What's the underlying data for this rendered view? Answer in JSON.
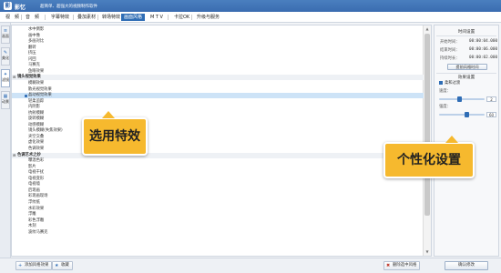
{
  "window": {
    "logo_glyph": "影",
    "app_name": "影忆",
    "slogan": "超简单、超强大的视频制作软件"
  },
  "menu": [
    "视",
    "频",
    "音",
    "频",
    "字幕特效",
    "叠加素材",
    "转场特效",
    "画面风格",
    "M T V",
    "卡拉OK",
    "升级与服务"
  ],
  "sidebar_tabs": [
    {
      "icon": "≡",
      "label": "画面"
    },
    {
      "icon": "✎",
      "label": "美化"
    },
    {
      "icon": "✦",
      "label": "滤镜"
    },
    {
      "icon": "▦",
      "label": "动景"
    }
  ],
  "effects": [
    {
      "type": "item",
      "label": "水中倒影"
    },
    {
      "type": "item",
      "label": "画中像"
    },
    {
      "type": "item",
      "label": "多画对比"
    },
    {
      "type": "item",
      "label": "翻转"
    },
    {
      "type": "item",
      "label": "挤压"
    },
    {
      "type": "item",
      "label": "闪回"
    },
    {
      "type": "item",
      "label": "马赛克"
    },
    {
      "type": "item",
      "label": "鱼眼效果"
    },
    {
      "type": "group",
      "toggle": "⊟",
      "label": "镜头视觉效果"
    },
    {
      "type": "item",
      "label": "模糊效果"
    },
    {
      "type": "item",
      "label": "散光视觉效果"
    },
    {
      "type": "selected",
      "label": "晶动视觉效果"
    },
    {
      "type": "item",
      "label": "轻柔追踪"
    },
    {
      "type": "item",
      "label": "内阴影"
    },
    {
      "type": "item",
      "label": "抗射模糊"
    },
    {
      "type": "item",
      "label": "旋转模糊"
    },
    {
      "type": "item",
      "label": "动感模糊"
    },
    {
      "type": "item",
      "label": "镜头模糊(失焦效果)"
    },
    {
      "type": "item",
      "label": "夹空交叠"
    },
    {
      "type": "item",
      "label": "虚化效果"
    },
    {
      "type": "item",
      "label": "色调效果"
    },
    {
      "type": "group",
      "toggle": "⊟",
      "label": "色调艺术之妙"
    },
    {
      "type": "item",
      "label": "曝温色彩"
    },
    {
      "type": "item",
      "label": "影片"
    },
    {
      "type": "item",
      "label": "电视干扰"
    },
    {
      "type": "item",
      "label": "电视变形"
    },
    {
      "type": "item",
      "label": "电视墙"
    },
    {
      "type": "item",
      "label": "后现画"
    },
    {
      "type": "item",
      "label": "彩现画现场"
    },
    {
      "type": "item",
      "label": "浮纹纸"
    },
    {
      "type": "item",
      "label": "水彩效果"
    },
    {
      "type": "item",
      "label": "浮雕"
    },
    {
      "type": "item",
      "label": "彩色浮雕"
    },
    {
      "type": "item",
      "label": "木刻"
    },
    {
      "type": "item",
      "label": "波纹马赛克"
    }
  ],
  "right_panel": {
    "time_section_title": "时间设置",
    "start_label": "开始时间：",
    "start_value": "00:00:04.000",
    "end_label": "结束时间：",
    "end_value": "00:00:06.000",
    "duration_label": "持续时长：",
    "duration_value": "00:00:02.000",
    "time_button": "提前风格时间",
    "effect_section_title": "效果设置",
    "checkbox_label": "柔和过渡",
    "speed_label": "速度：",
    "speed_value": "2",
    "intensity_label": "强度：",
    "intensity_value": "60",
    "confirm_button": "确认修改"
  },
  "bottom_bar": {
    "add_button": "添加风格效果",
    "add_icon": "+",
    "favorite_button": "收藏",
    "favorite_icon": "★",
    "delete_button": "删除选中风格",
    "delete_icon": "✖"
  },
  "callouts": {
    "select_effect": "选用特效",
    "personalize": "个性化设置"
  },
  "colors": {
    "accent": "#2f6db5",
    "callout": "#f6b92e",
    "selected_row": "#cde3f7"
  }
}
